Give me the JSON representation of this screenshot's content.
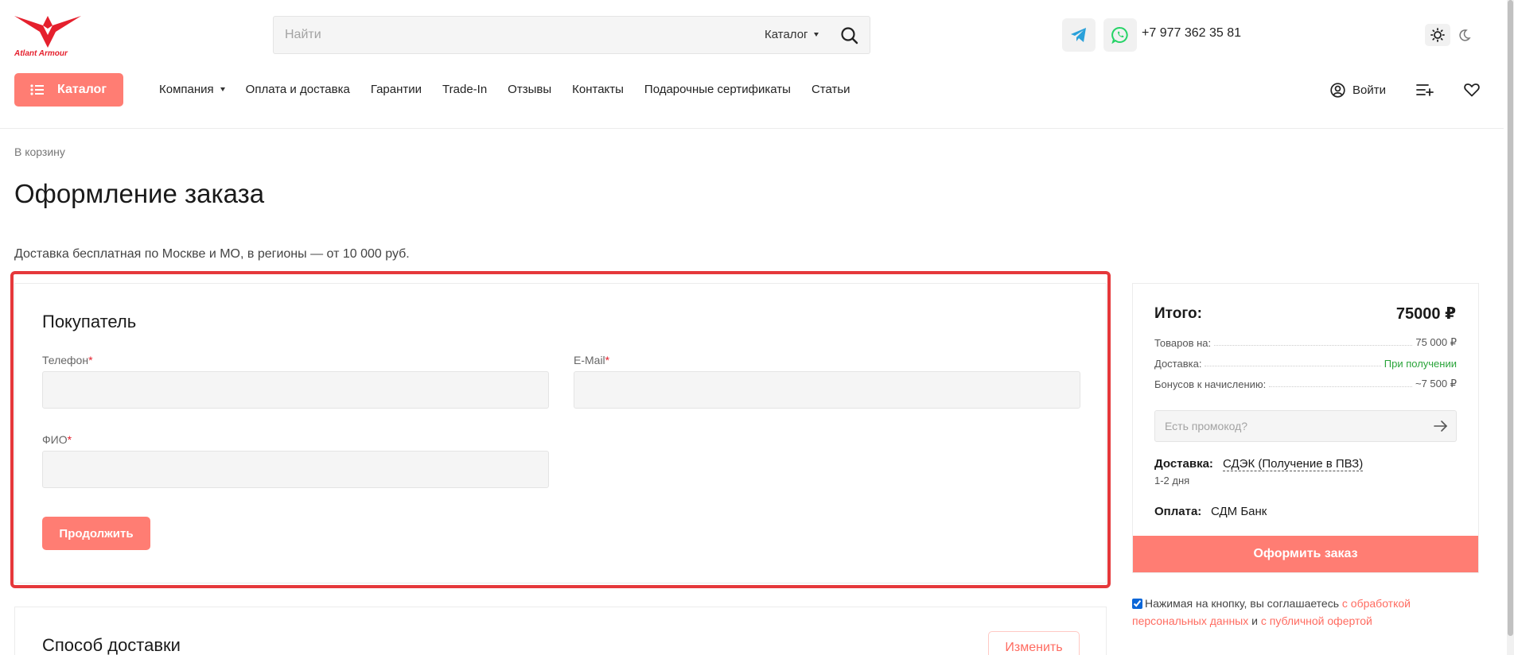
{
  "header": {
    "logo_text": "Atlant Armour",
    "search": {
      "placeholder": "Найти",
      "category": "Каталог"
    },
    "phone": "+7 977 362 35 81",
    "catalog_button": "Каталог",
    "nav": [
      {
        "label": "Компания",
        "has_dropdown": true
      },
      {
        "label": "Оплата и доставка"
      },
      {
        "label": "Гарантии"
      },
      {
        "label": "Trade-In"
      },
      {
        "label": "Отзывы"
      },
      {
        "label": "Контакты"
      },
      {
        "label": "Подарочные сертификаты"
      },
      {
        "label": "Статьи"
      }
    ],
    "login_label": "Войти"
  },
  "page": {
    "breadcrumb": "В корзину",
    "title": "Оформление заказа",
    "delivery_note": "Доставка бесплатная по Москве и МО, в регионы — от 10 000 руб."
  },
  "buyer": {
    "title": "Покупатель",
    "fields": {
      "phone_label": "Телефон",
      "email_label": "E-Mail",
      "name_label": "ФИО",
      "required_mark": "*"
    },
    "continue_button": "Продолжить"
  },
  "delivery_method": {
    "title": "Способ доставки",
    "change_button": "Изменить"
  },
  "summary": {
    "title": "Итого:",
    "total": "75000 ₽",
    "rows": [
      {
        "key": "Товаров на:",
        "value": "75 000 ₽"
      },
      {
        "key": "Доставка:",
        "value": "При получении"
      },
      {
        "key": "Бонусов к начислению:",
        "value": "~7 500 ₽"
      }
    ],
    "promo_placeholder": "Есть промокод?",
    "delivery_label": "Доставка:",
    "delivery_value": "СДЭК (Получение в ПВЗ)",
    "delivery_time": "1-2 дня",
    "payment_label": "Оплата:",
    "payment_value": "СДМ Банк",
    "order_button": "Оформить заказ"
  },
  "agreement": {
    "checked": true,
    "text_before": "Нажимая на кнопку, вы соглашаетесь ",
    "link1": "с обработкой персональных данных",
    "text_mid": " и ",
    "link2": "с публичной офертой"
  },
  "colors": {
    "accent": "#ff7d73",
    "brand_red": "#e5202d",
    "highlight": "#e5383b",
    "success": "#2aa43a",
    "telegram": "#2aa1da",
    "whatsapp": "#25d366"
  },
  "icons": [
    "logo-emblem-icon",
    "search-icon",
    "telegram-icon",
    "whatsapp-icon",
    "sun-icon",
    "moon-icon",
    "menu-list-icon",
    "user-icon",
    "compare-icon",
    "heart-icon",
    "arrow-right-icon"
  ]
}
